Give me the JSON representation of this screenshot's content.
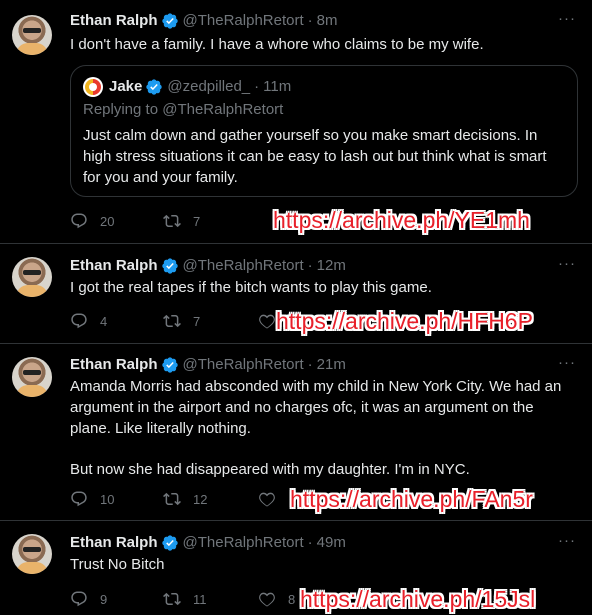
{
  "tweets": [
    {
      "name": "Ethan Ralph",
      "handle": "@TheRalphRetort",
      "time": "8m",
      "text": [
        "I don't have a family. I have a whore who claims to be my wife."
      ],
      "quote": {
        "name": "Jake",
        "handle": "@zedpilled_",
        "time": "11m",
        "reply": "Replying to @TheRalphRetort",
        "text": "Just calm down and gather yourself so you make smart decisions. In high stress situations it can be easy to lash out but think what is smart for you and your family."
      },
      "replies": "20",
      "retweets": "7",
      "likes": "",
      "archive": "https://archive.ph/YE1mh"
    },
    {
      "name": "Ethan Ralph",
      "handle": "@TheRalphRetort",
      "time": "12m",
      "text": [
        "I got the real tapes if the bitch wants to play this game."
      ],
      "replies": "4",
      "retweets": "7",
      "likes": "",
      "archive": "https://archive.ph/HFH6P"
    },
    {
      "name": "Ethan Ralph",
      "handle": "@TheRalphRetort",
      "time": "21m",
      "text": [
        "Amanda Morris had absconded with my child in New York City. We had an argument in the airport and no charges ofc, it was an argument on the plane. Like literally nothing.",
        "But now she had disappeared with my daughter. I'm in NYC."
      ],
      "replies": "10",
      "retweets": "12",
      "likes": "",
      "archive": "https://archive.ph/FAn5r"
    },
    {
      "name": "Ethan Ralph",
      "handle": "@TheRalphRetort",
      "time": "49m",
      "text": [
        "Trust No Bitch"
      ],
      "replies": "9",
      "retweets": "11",
      "likes": "8",
      "archive": "https://archive.ph/15Jsl"
    }
  ],
  "separator": "·",
  "more_label": "···",
  "colors": {
    "background": "#000000",
    "text": "#e7e9ea",
    "muted": "#71767b",
    "verified": "#1d9bf0",
    "archive_text": "#e8202a"
  },
  "icons": [
    "verified-badge-icon",
    "reply-icon",
    "retweet-icon",
    "like-icon",
    "more-icon"
  ]
}
